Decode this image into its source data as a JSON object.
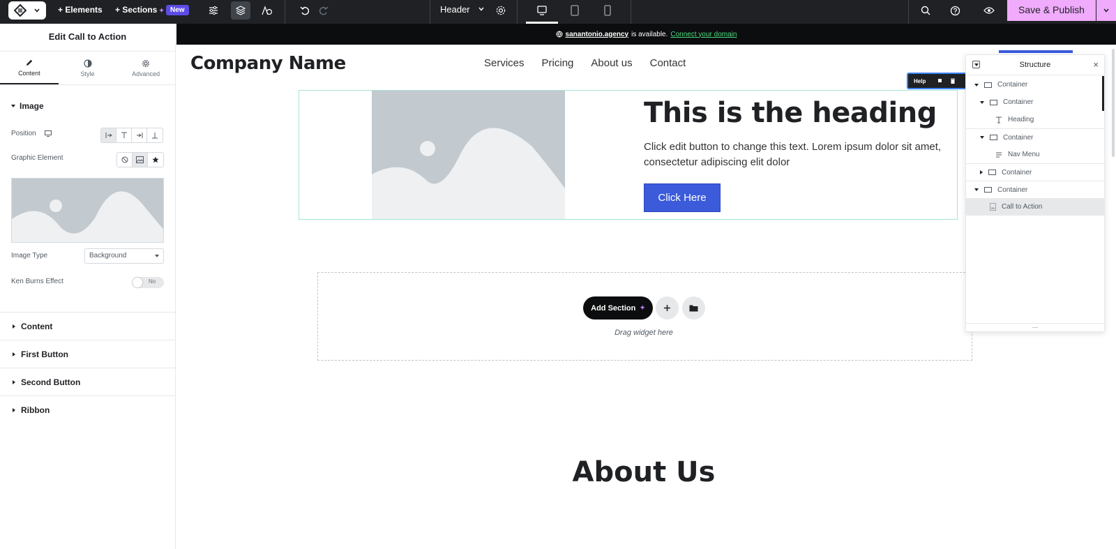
{
  "topbar": {
    "elements_label": "Elements",
    "sections_label": "Sections",
    "new_badge": "New",
    "document_title": "Header",
    "publish_label": "Save & Publish"
  },
  "panel": {
    "title": "Edit Call to Action",
    "tabs": [
      {
        "label": "Content",
        "icon": "pencil-icon",
        "active": true
      },
      {
        "label": "Style",
        "icon": "half-circle-icon",
        "active": false
      },
      {
        "label": "Advanced",
        "icon": "gear-icon",
        "active": false
      }
    ],
    "image_section": "Image",
    "position_label": "Position",
    "graphic_element_label": "Graphic Element",
    "image_type_label": "Image Type",
    "image_type_value": "Background",
    "ken_burns_label": "Ken Burns Effect",
    "ken_burns_toggle": "No",
    "accordions": [
      "Content",
      "First Button",
      "Second Button",
      "Ribbon"
    ]
  },
  "canvas": {
    "notice": {
      "domain": "sanantonio.agency",
      "text": "is available.",
      "link": "Connect your domain"
    },
    "company_name": "Company Name",
    "nav": [
      "Services",
      "Pricing",
      "About us",
      "Contact"
    ],
    "help_label": "Help",
    "cta": {
      "heading": "This is the heading",
      "text": "Click edit button to change this text. Lorem ipsum dolor sit amet, consectetur adipiscing elit dolor",
      "button": "Click Here"
    },
    "add_section_label": "Add Section",
    "drag_hint": "Drag widget here",
    "about_heading": "About Us"
  },
  "structure": {
    "title": "Structure",
    "items": [
      {
        "label": "Container",
        "level": 0,
        "expanded": true
      },
      {
        "label": "Container",
        "level": 1,
        "expanded": true
      },
      {
        "label": "Heading",
        "level": 2
      },
      {
        "label": "Container",
        "level": 1,
        "expanded": true
      },
      {
        "label": "Nav Menu",
        "level": 2
      },
      {
        "label": "Container",
        "level": 1,
        "expanded": false
      },
      {
        "label": "Container",
        "level": 0,
        "expanded": true
      },
      {
        "label": "Call to Action",
        "level": 1,
        "selected": true
      }
    ]
  },
  "colors": {
    "topbar_bg": "#1f2124",
    "publish_bg": "#f0abfc",
    "accent_blue": "#3b5bdb",
    "new_badge": "#5c4ce6",
    "link_green": "#4ade80"
  }
}
